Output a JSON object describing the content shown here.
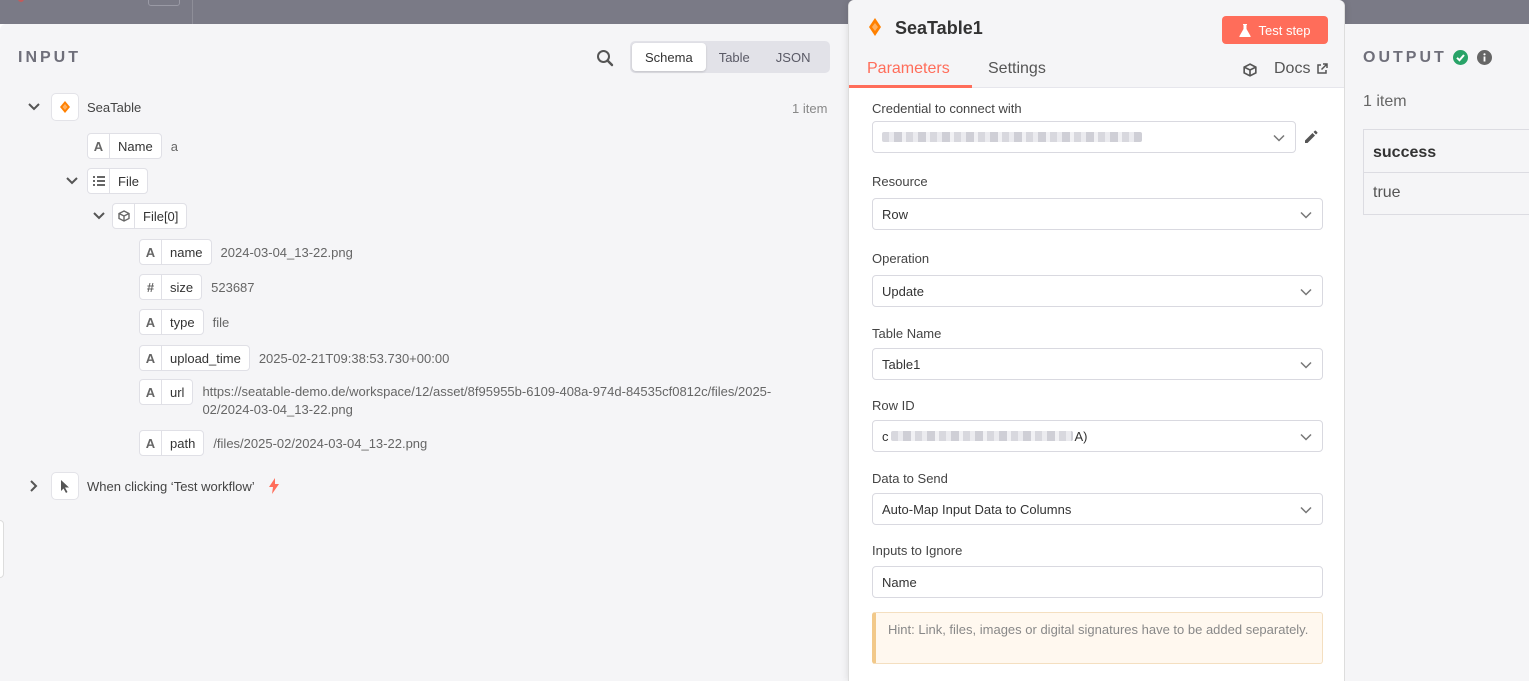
{
  "input": {
    "title": "INPUT",
    "view_options": [
      "Schema",
      "Table",
      "JSON"
    ],
    "item_count": "1 item",
    "node_name": "SeaTable",
    "fields": {
      "name_field": {
        "type": "A",
        "label": "Name",
        "value": "a"
      },
      "file_field": {
        "label": "File"
      },
      "file0_field": {
        "label": "File[0]"
      },
      "name": {
        "type": "A",
        "label": "name",
        "value": "2024-03-04_13-22.png"
      },
      "size": {
        "type": "#",
        "label": "size",
        "value": "523687"
      },
      "type": {
        "type": "A",
        "label": "type",
        "value": "file"
      },
      "upload_time": {
        "type": "A",
        "label": "upload_time",
        "value": "2025-02-21T09:38:53.730+00:00"
      },
      "url": {
        "type": "A",
        "label": "url",
        "value_line1": "https://seatable-demo.de/workspace/12/asset/8f95955b-6109-408a-974d-84535cf0812c/files/2025-",
        "value_line2": "02/2024-03-04_13-22.png"
      },
      "path": {
        "type": "A",
        "label": "path",
        "value": "/files/2025-02/2024-03-04_13-22.png"
      }
    },
    "trigger_node": "When clicking ‘Test workflow’"
  },
  "params": {
    "node_title": "SeaTable1",
    "test_step_label": "Test step",
    "tabs": [
      "Parameters",
      "Settings"
    ],
    "docs_label": "Docs",
    "credential_label": "Credential to connect with",
    "resource_label": "Resource",
    "resource_value": "Row",
    "operation_label": "Operation",
    "operation_value": "Update",
    "table_name_label": "Table Name",
    "table_name_value": "Table1",
    "row_id_label": "Row ID",
    "row_id_prefix": "c",
    "row_id_suffix": "A)",
    "data_to_send_label": "Data to Send",
    "data_to_send_value": "Auto-Map Input Data to Columns",
    "inputs_to_ignore_label": "Inputs to Ignore",
    "inputs_to_ignore_value": "Name",
    "hint": "Hint: Link, files, images or digital signatures have to be added separately."
  },
  "output": {
    "title": "OUTPUT",
    "item_count": "1 item",
    "column": "success",
    "value": "true"
  },
  "colors": {
    "accent": "#ff6d5a",
    "success": "#29a368",
    "seatable_orange": "#ff8000"
  }
}
